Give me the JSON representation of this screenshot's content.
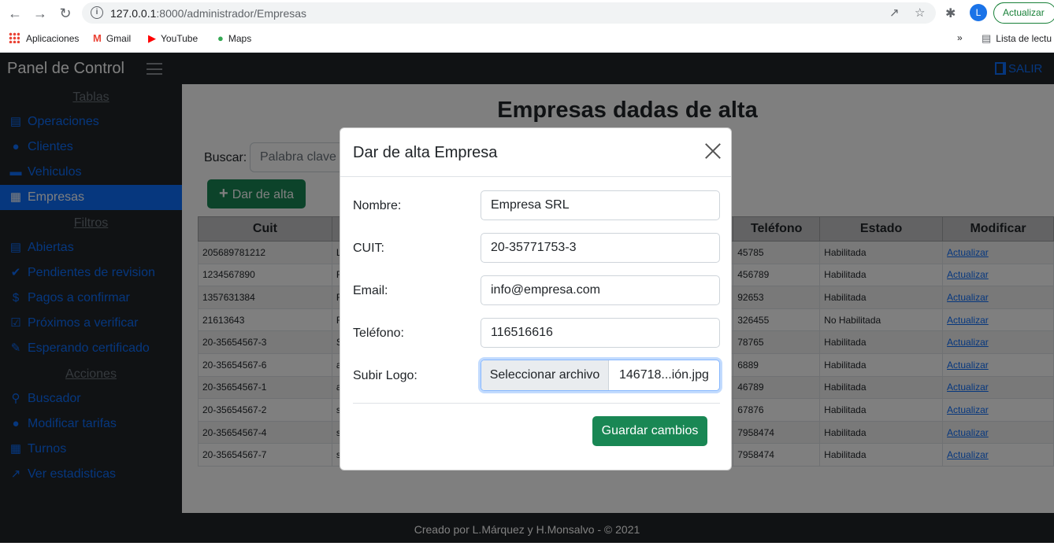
{
  "browser": {
    "url_host": "127.0.0.1",
    "url_path": ":8000/administrador/Empresas",
    "update_label": "Actualizar",
    "avatar_letter": "L",
    "bookmarks": [
      "Aplicaciones",
      "Gmail",
      "YouTube",
      "Maps"
    ],
    "reading_list": "Lista de lectu",
    "more_bookmarks": "»"
  },
  "navbar": {
    "brand": "Panel de Control",
    "logout_label": "SALIR"
  },
  "sidebar": {
    "section_tables": "Tablas",
    "section_filters": "Filtros",
    "section_actions": "Acciones",
    "tables": [
      "Operaciones",
      "Clientes",
      "Vehiculos",
      "Empresas"
    ],
    "filters": [
      "Abiertas",
      "Pendientes de revision",
      "Pagos a confirmar",
      "Próximos a verificar",
      "Esperando certificado"
    ],
    "actions": [
      "Buscador",
      "Modificar tarifas",
      "Turnos",
      "Ver estadisticas"
    ],
    "active_item": "Empresas"
  },
  "main": {
    "title": "Empresas dadas de alta",
    "search_label": "Buscar:",
    "search_placeholder": "Palabra clave",
    "add_label": "Dar de alta",
    "table": {
      "headers": [
        "Cuit",
        "",
        "",
        "",
        "Teléfono",
        "Estado",
        "Modificar"
      ],
      "rows": [
        {
          "cuit": "205689781212",
          "name": "L",
          "phone": "45785",
          "estado": "Habilitada",
          "link": "Actualizar"
        },
        {
          "cuit": "1234567890",
          "name": "F",
          "phone": "456789",
          "estado": "Habilitada",
          "link": "Actualizar"
        },
        {
          "cuit": "1357631384",
          "name": "F",
          "phone": "92653",
          "estado": "Habilitada",
          "link": "Actualizar"
        },
        {
          "cuit": "21613643",
          "name": "F",
          "phone": "326455",
          "estado": "No Habilitada",
          "link": "Actualizar"
        },
        {
          "cuit": "20-35654567-3",
          "name": "S",
          "phone": "78765",
          "estado": "Habilitada",
          "link": "Actualizar"
        },
        {
          "cuit": "20-35654567-6",
          "name": "a",
          "phone": "6889",
          "estado": "Habilitada",
          "link": "Actualizar"
        },
        {
          "cuit": "20-35654567-1",
          "name": "a",
          "phone": "46789",
          "estado": "Habilitada",
          "link": "Actualizar"
        },
        {
          "cuit": "20-35654567-2",
          "name": "s",
          "phone": "67876",
          "estado": "Habilitada",
          "link": "Actualizar"
        },
        {
          "cuit": "20-35654567-4",
          "name": "s",
          "phone": "7958474",
          "estado": "Habilitada",
          "link": "Actualizar"
        },
        {
          "cuit": "20-35654567-7",
          "name": "s",
          "phone": "7958474",
          "estado": "Habilitada",
          "link": "Actualizar"
        }
      ]
    }
  },
  "modal": {
    "title": "Dar de alta Empresa",
    "fields": {
      "nombre_label": "Nombre:",
      "nombre_value": "Empresa SRL",
      "cuit_label": "CUIT:",
      "cuit_value": "20-35771753-3",
      "email_label": "Email:",
      "email_value": "info@empresa.com",
      "telefono_label": "Teléfono:",
      "telefono_value": "116516616",
      "logo_label": "Subir Logo:",
      "logo_button": "Seleccionar archivo",
      "logo_filename": "146718...ión.jpg"
    },
    "save_label": "Guardar cambios"
  },
  "footer": {
    "text": "Creado por L.Márquez y H.Monsalvo - © 2021"
  },
  "colors": {
    "primary": "#0d6efd",
    "success": "#198754",
    "dark": "#212529"
  }
}
